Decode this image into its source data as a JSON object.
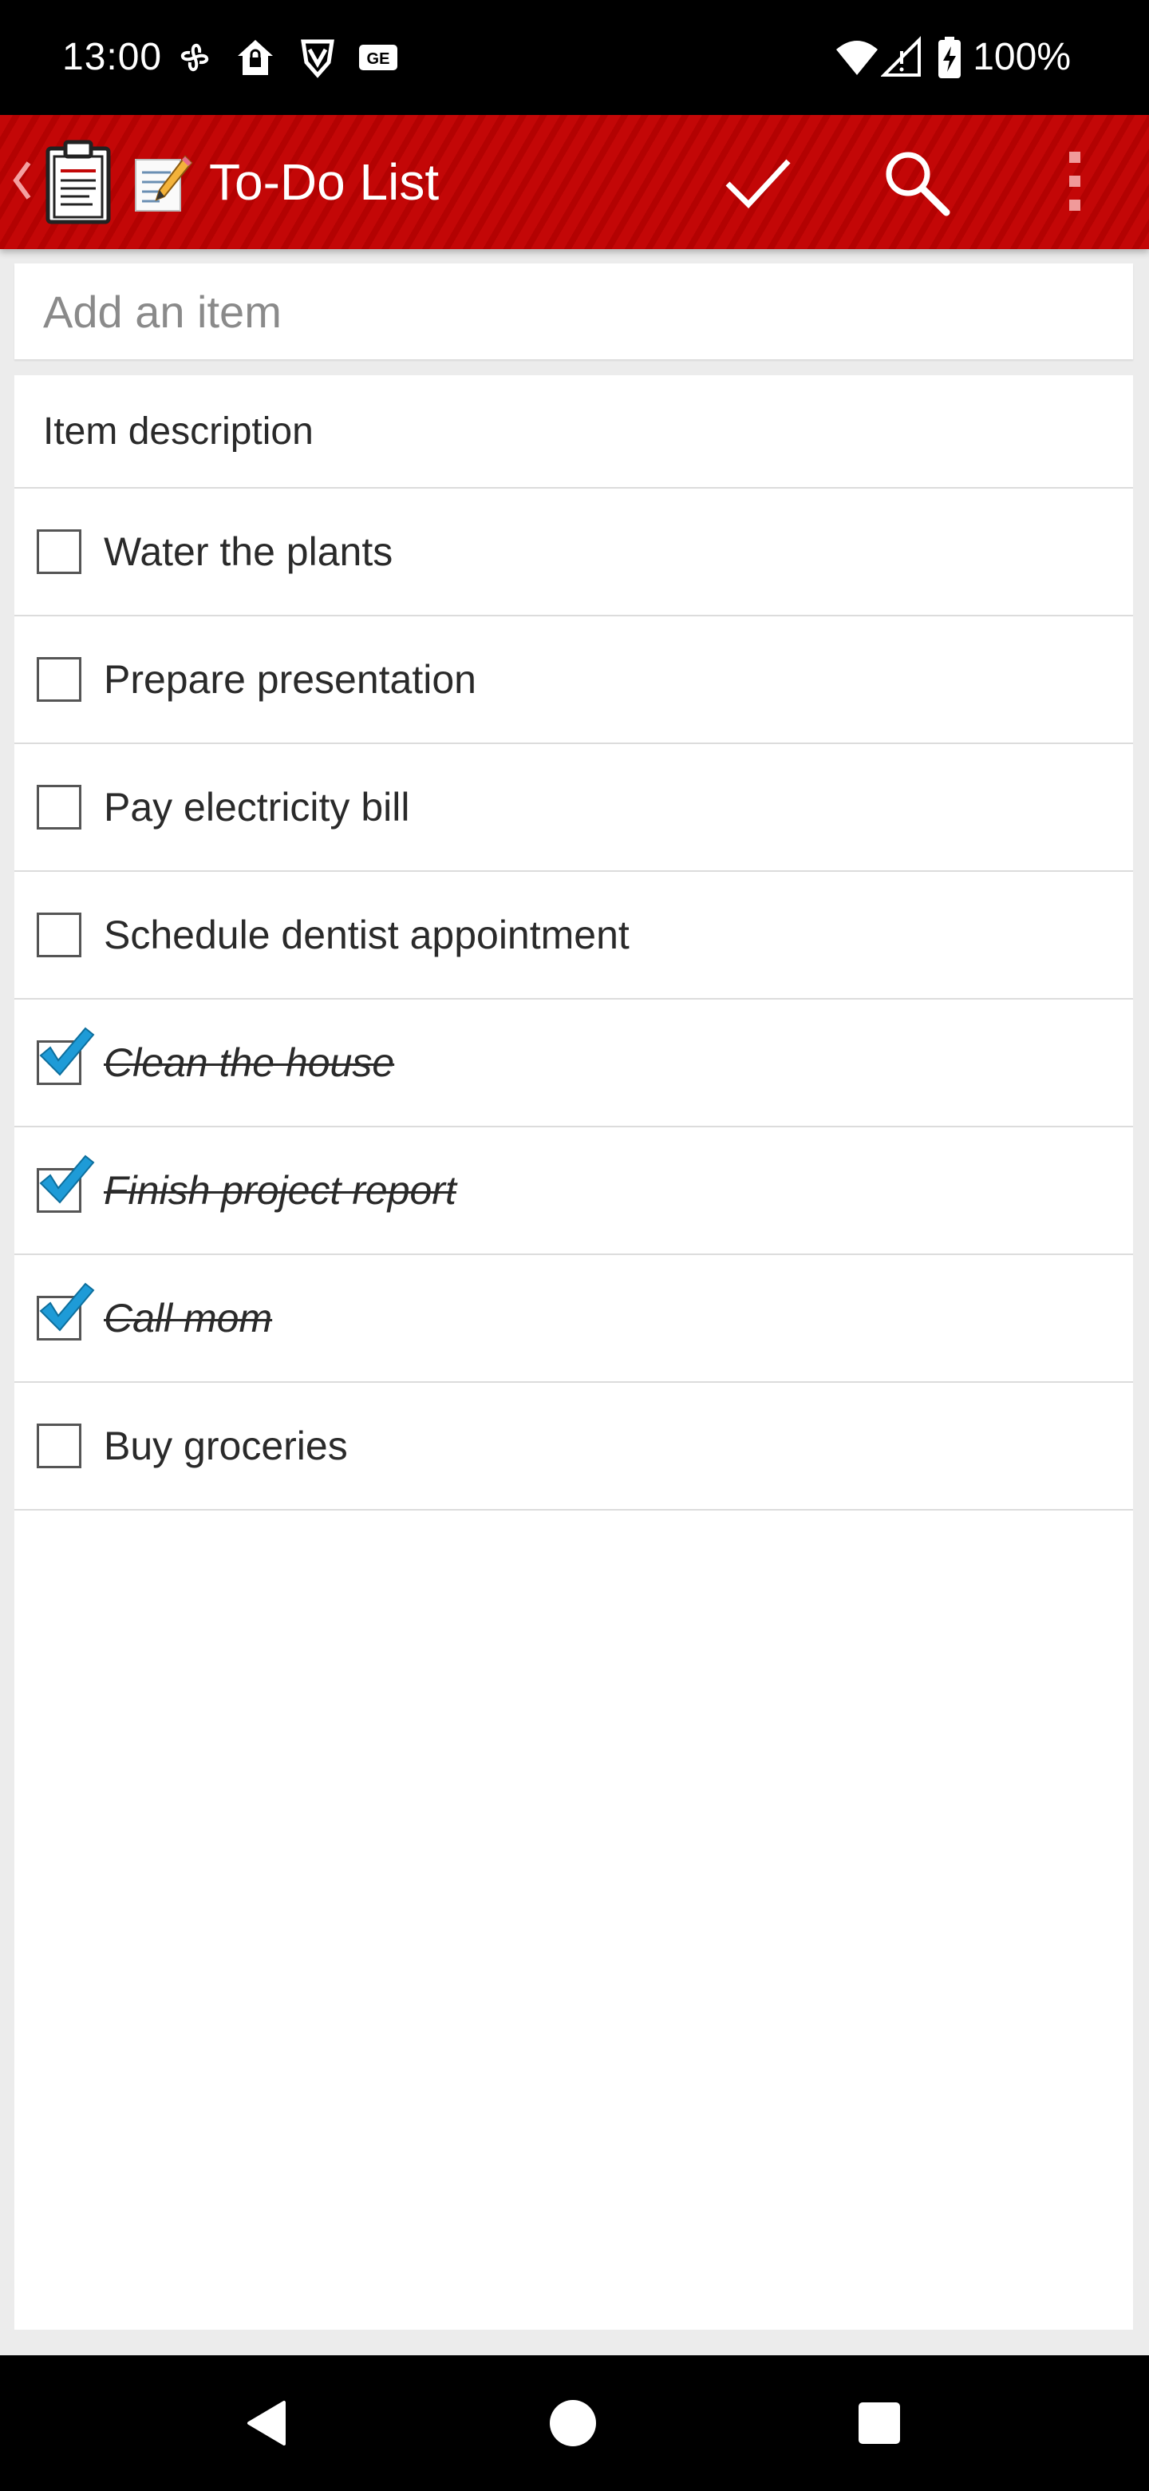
{
  "status_bar": {
    "time": "13:00",
    "battery": "100%",
    "icons_left": [
      "pinwheel-icon",
      "home-lock-icon",
      "brave-icon",
      "ge-icon"
    ],
    "icons_right": [
      "wifi-icon",
      "cell-signal-icon",
      "battery-charging-icon"
    ]
  },
  "app_bar": {
    "title": "To-Do List",
    "background_color": "#C30707",
    "actions": [
      "checkmark-icon",
      "search-icon",
      "overflow-menu-icon"
    ]
  },
  "add_item": {
    "placeholder": "Add an item",
    "value": ""
  },
  "list": {
    "header": "Item description",
    "items": [
      {
        "label": "Water the plants",
        "checked": false
      },
      {
        "label": "Prepare presentation",
        "checked": false
      },
      {
        "label": "Pay electricity bill",
        "checked": false
      },
      {
        "label": "Schedule dentist appointment",
        "checked": false
      },
      {
        "label": "Clean the house",
        "checked": true
      },
      {
        "label": "Finish project report",
        "checked": true
      },
      {
        "label": "Call mom",
        "checked": true
      },
      {
        "label": "Buy groceries",
        "checked": false
      }
    ],
    "check_color": "#1E9BD7"
  },
  "nav_bar": {
    "buttons": [
      "back-icon",
      "home-icon",
      "recents-icon"
    ]
  }
}
